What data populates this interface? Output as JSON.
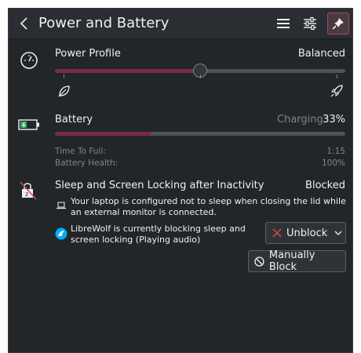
{
  "header": {
    "title": "Power and Battery"
  },
  "power_profile": {
    "label": "Power Profile",
    "value": "Balanced",
    "slider_level": 0.5
  },
  "battery": {
    "label": "Battery",
    "status": "Charging",
    "percent": "33%",
    "level": 0.33,
    "time_to_full_label": "Time To Full:",
    "time_to_full_value": "1:15",
    "health_label": "Battery Health:",
    "health_value": "100%"
  },
  "sleep": {
    "label": "Sleep and Screen Locking after Inactivity",
    "status": "Blocked",
    "laptop_note": "Your laptop is configured not to sleep when closing the lid while an external monitor is connected.",
    "app_note": "LibreWolf is currently blocking sleep and screen locking (Playing audio)",
    "unblock_label": "Unblock",
    "manual_block_label": "Manually Block"
  },
  "colors": {
    "accent": "#7a2a48",
    "panel_bg": "#232629",
    "header_bg": "#2a2e32"
  }
}
